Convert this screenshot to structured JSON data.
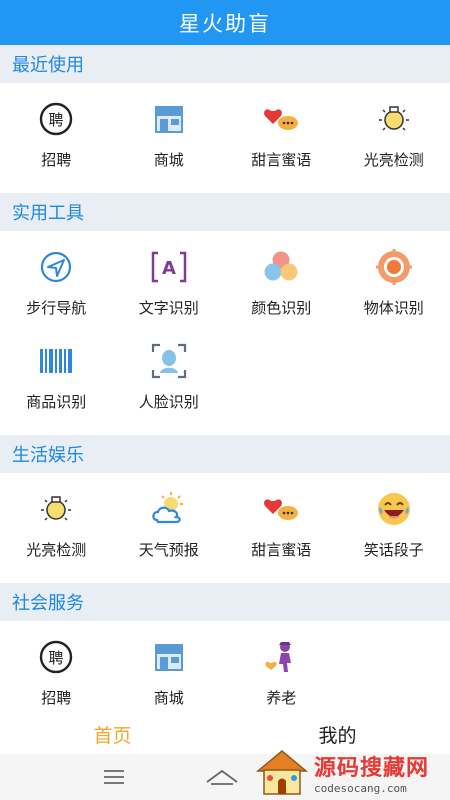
{
  "app": {
    "title": "星火助盲"
  },
  "colors": {
    "primary": "#2196F3",
    "section_bg": "#E8EEF3",
    "tab_active": "#F2A62B"
  },
  "sections": [
    {
      "title": "最近使用",
      "items": [
        {
          "label": "招聘",
          "icon": "recruit-icon"
        },
        {
          "label": "商城",
          "icon": "store-icon"
        },
        {
          "label": "甜言蜜语",
          "icon": "hearts-chat-icon"
        },
        {
          "label": "光亮检测",
          "icon": "lightbulb-icon"
        }
      ]
    },
    {
      "title": "实用工具",
      "items": [
        {
          "label": "步行导航",
          "icon": "navigation-icon"
        },
        {
          "label": "文字识别",
          "icon": "text-scan-icon"
        },
        {
          "label": "颜色识别",
          "icon": "color-circles-icon"
        },
        {
          "label": "物体识别",
          "icon": "object-target-icon"
        },
        {
          "label": "商品识别",
          "icon": "barcode-icon"
        },
        {
          "label": "人脸识别",
          "icon": "face-scan-icon"
        }
      ]
    },
    {
      "title": "生活娱乐",
      "items": [
        {
          "label": "光亮检测",
          "icon": "lightbulb-icon"
        },
        {
          "label": "天气预报",
          "icon": "weather-icon"
        },
        {
          "label": "甜言蜜语",
          "icon": "hearts-chat-icon"
        },
        {
          "label": "笑话段子",
          "icon": "laughing-emoji-icon"
        }
      ]
    },
    {
      "title": "社会服务",
      "items": [
        {
          "label": "招聘",
          "icon": "recruit-icon"
        },
        {
          "label": "商城",
          "icon": "store-icon"
        },
        {
          "label": "养老",
          "icon": "elderly-care-icon"
        }
      ]
    }
  ],
  "tabs": [
    {
      "label": "首页",
      "active": true
    },
    {
      "label": "我的",
      "active": false
    }
  ],
  "system_nav": {
    "menu_icon": "menu-icon",
    "home_icon": "home-icon"
  },
  "watermark": {
    "main": "源码搜藏网",
    "sub": "codesocang.com"
  }
}
